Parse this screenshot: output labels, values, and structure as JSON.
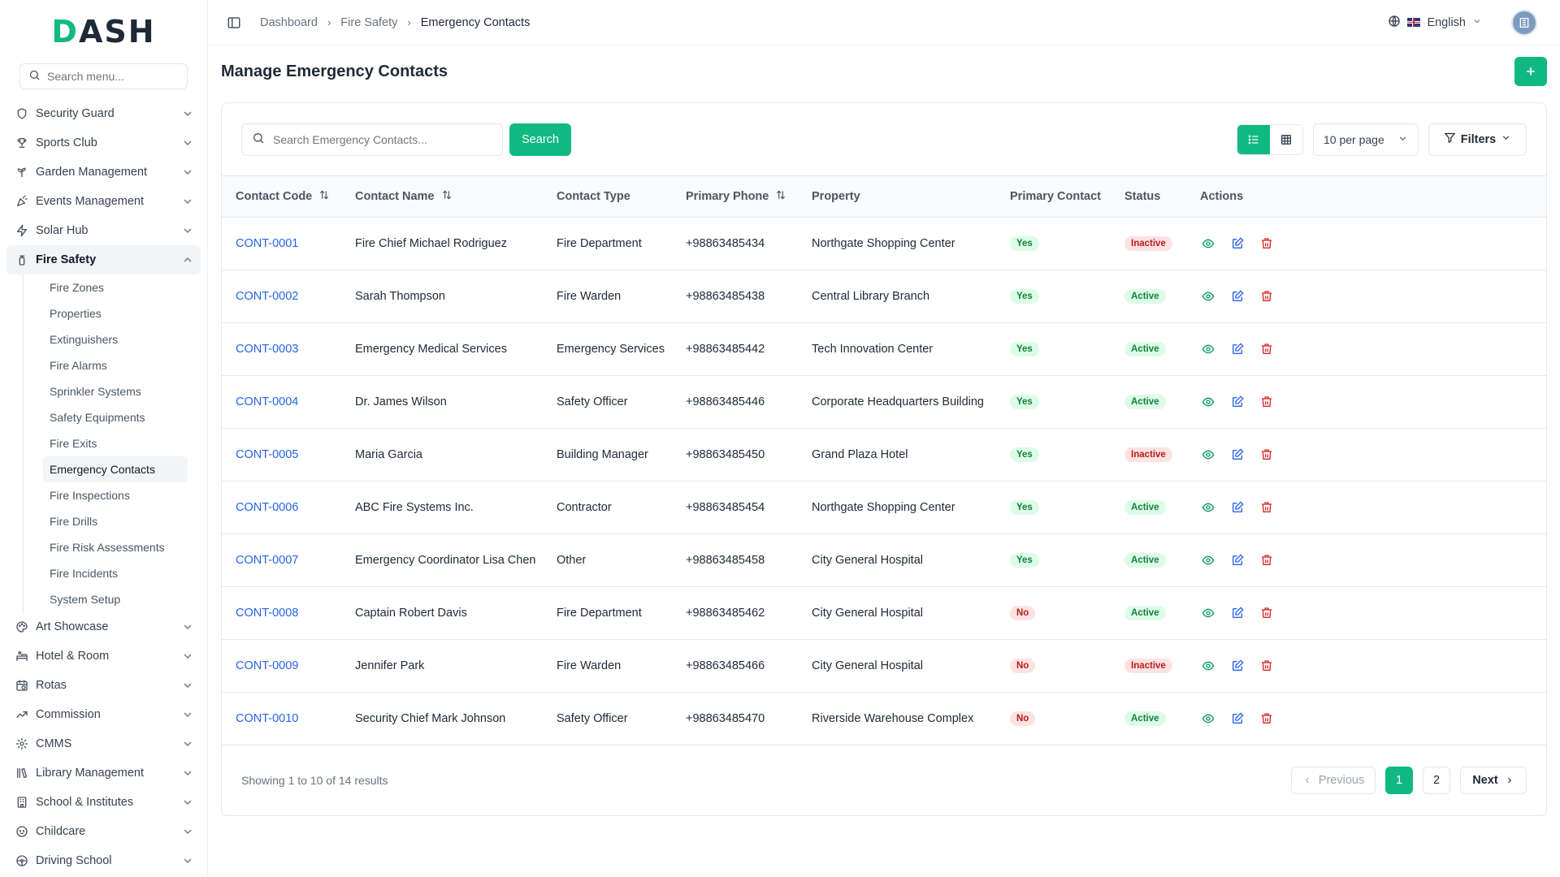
{
  "brand": {
    "logo_text": "DASH",
    "accent": "#10b981"
  },
  "sidebar": {
    "search_placeholder": "Search menu...",
    "top_items": [
      {
        "label": "Security Guard",
        "icon": "shield-icon"
      },
      {
        "label": "Sports Club",
        "icon": "trophy-icon"
      },
      {
        "label": "Garden Management",
        "icon": "sprout-icon"
      },
      {
        "label": "Events Management",
        "icon": "party-icon"
      },
      {
        "label": "Solar Hub",
        "icon": "bolt-icon"
      }
    ],
    "active_group": {
      "label": "Fire Safety",
      "icon": "fire-extinguisher-icon"
    },
    "sub_items": [
      "Fire Zones",
      "Properties",
      "Extinguishers",
      "Fire Alarms",
      "Sprinkler Systems",
      "Safety Equipments",
      "Fire Exits",
      "Emergency Contacts",
      "Fire Inspections",
      "Fire Drills",
      "Fire Risk Assessments",
      "Fire Incidents",
      "System Setup"
    ],
    "active_sub_index": 7,
    "bottom_items": [
      {
        "label": "Art Showcase",
        "icon": "palette-icon"
      },
      {
        "label": "Hotel & Room",
        "icon": "hotel-icon"
      },
      {
        "label": "Rotas",
        "icon": "calendar-clock-icon"
      },
      {
        "label": "Commission",
        "icon": "trending-up-icon"
      },
      {
        "label": "CMMS",
        "icon": "cog-icon"
      },
      {
        "label": "Library Management",
        "icon": "library-icon"
      },
      {
        "label": "School & Institutes",
        "icon": "building-icon"
      },
      {
        "label": "Childcare",
        "icon": "baby-icon"
      },
      {
        "label": "Driving School",
        "icon": "steering-wheel-icon"
      }
    ]
  },
  "header": {
    "breadcrumbs": [
      "Dashboard",
      "Fire Safety",
      "Emergency Contacts"
    ],
    "language": "English"
  },
  "page": {
    "title": "Manage Emergency Contacts",
    "search_placeholder": "Search Emergency Contacts...",
    "search_button": "Search",
    "per_page": "10 per page",
    "filters_label": "Filters"
  },
  "table": {
    "columns": [
      "Contact Code",
      "Contact Name",
      "Contact Type",
      "Primary Phone",
      "Property",
      "Primary Contact",
      "Status",
      "Actions"
    ],
    "rows": [
      {
        "code": "CONT-0001",
        "name": "Fire Chief Michael Rodriguez",
        "type": "Fire Department",
        "phone": "+98863485434",
        "property": "Northgate Shopping Center",
        "primary": "Yes",
        "status": "Inactive"
      },
      {
        "code": "CONT-0002",
        "name": "Sarah Thompson",
        "type": "Fire Warden",
        "phone": "+98863485438",
        "property": "Central Library Branch",
        "primary": "Yes",
        "status": "Active"
      },
      {
        "code": "CONT-0003",
        "name": "Emergency Medical Services",
        "type": "Emergency Services",
        "phone": "+98863485442",
        "property": "Tech Innovation Center",
        "primary": "Yes",
        "status": "Active"
      },
      {
        "code": "CONT-0004",
        "name": "Dr. James Wilson",
        "type": "Safety Officer",
        "phone": "+98863485446",
        "property": "Corporate Headquarters Building",
        "primary": "Yes",
        "status": "Active"
      },
      {
        "code": "CONT-0005",
        "name": "Maria Garcia",
        "type": "Building Manager",
        "phone": "+98863485450",
        "property": "Grand Plaza Hotel",
        "primary": "Yes",
        "status": "Inactive"
      },
      {
        "code": "CONT-0006",
        "name": "ABC Fire Systems Inc.",
        "type": "Contractor",
        "phone": "+98863485454",
        "property": "Northgate Shopping Center",
        "primary": "Yes",
        "status": "Active"
      },
      {
        "code": "CONT-0007",
        "name": "Emergency Coordinator Lisa Chen",
        "type": "Other",
        "phone": "+98863485458",
        "property": "City General Hospital",
        "primary": "Yes",
        "status": "Active"
      },
      {
        "code": "CONT-0008",
        "name": "Captain Robert Davis",
        "type": "Fire Department",
        "phone": "+98863485462",
        "property": "City General Hospital",
        "primary": "No",
        "status": "Active"
      },
      {
        "code": "CONT-0009",
        "name": "Jennifer Park",
        "type": "Fire Warden",
        "phone": "+98863485466",
        "property": "City General Hospital",
        "primary": "No",
        "status": "Inactive"
      },
      {
        "code": "CONT-0010",
        "name": "Security Chief Mark Johnson",
        "type": "Safety Officer",
        "phone": "+98863485470",
        "property": "Riverside Warehouse Complex",
        "primary": "No",
        "status": "Active"
      }
    ]
  },
  "pagination": {
    "summary": "Showing 1 to 10 of 14 results",
    "previous": "Previous",
    "next": "Next",
    "pages": [
      "1",
      "2"
    ],
    "current": "1"
  }
}
